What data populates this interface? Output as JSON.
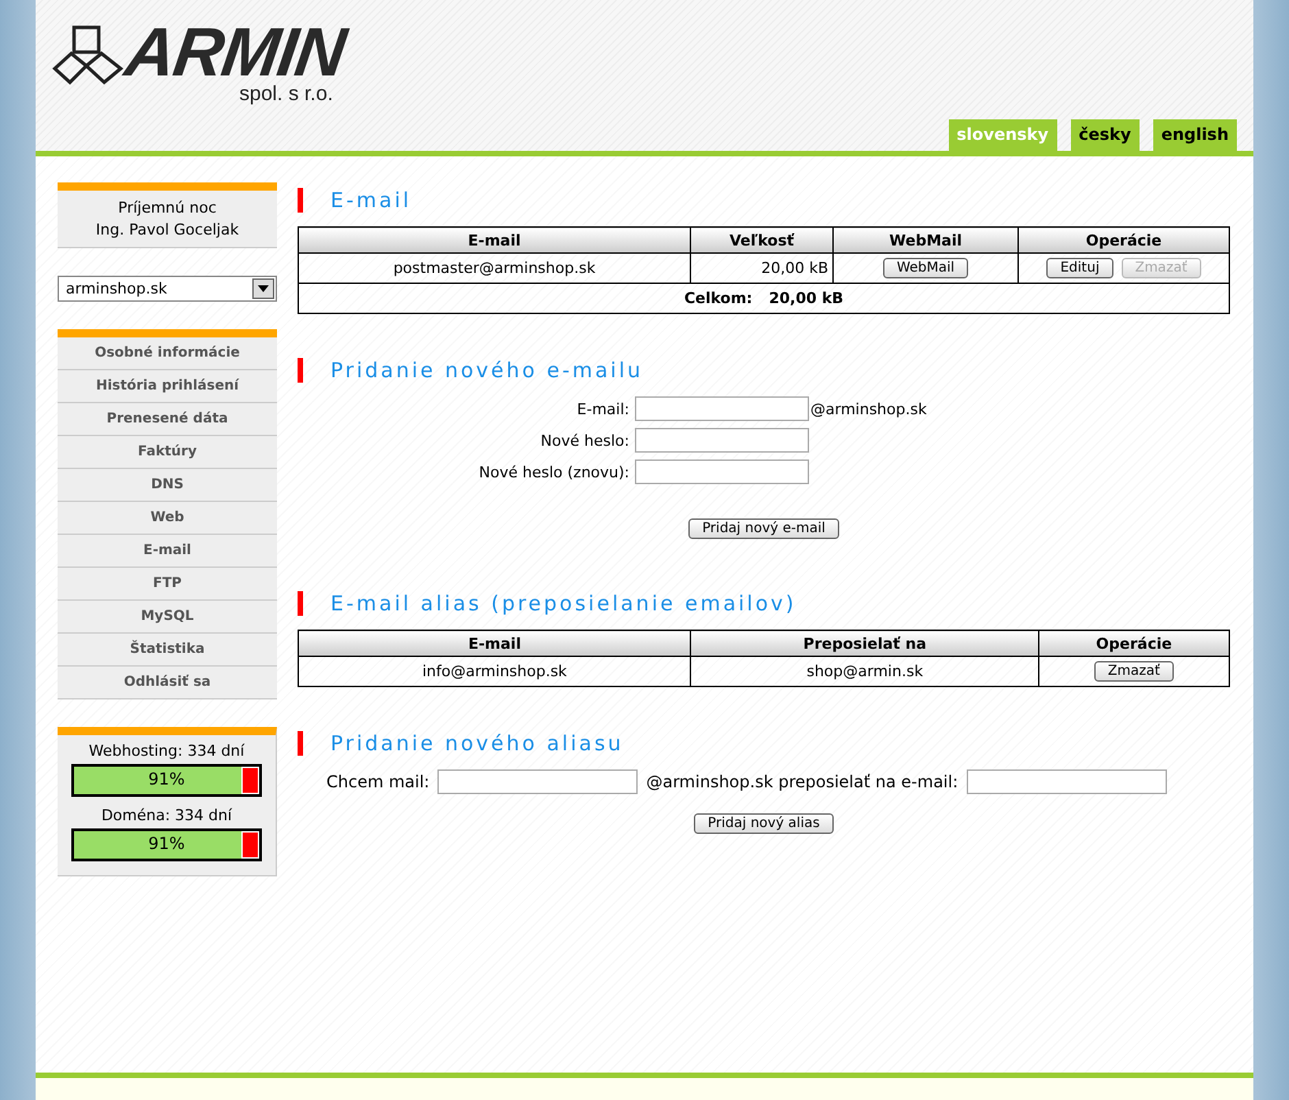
{
  "header": {
    "logo_name": "ARMIN",
    "logo_sub": "spol. s r.o.",
    "languages": [
      {
        "label": "slovensky",
        "selected": true
      },
      {
        "label": "česky",
        "selected": false
      },
      {
        "label": "english",
        "selected": false
      }
    ]
  },
  "sidebar": {
    "greeting": [
      "Príjemnú noc",
      "Ing. Pavol Goceljak"
    ],
    "domain_select": {
      "value": "arminshop.sk"
    },
    "menu": [
      {
        "label": "Osobné informácie"
      },
      {
        "label": "História prihlásení"
      },
      {
        "label": "Prenesené dáta"
      },
      {
        "label": "Faktúry"
      },
      {
        "label": "DNS"
      },
      {
        "label": "Web"
      },
      {
        "label": "E-mail"
      },
      {
        "label": "FTP"
      },
      {
        "label": "MySQL"
      },
      {
        "label": "Štatistika"
      },
      {
        "label": "Odhlásiť sa"
      }
    ],
    "quotas": [
      {
        "label": "Webhosting: 334 dní",
        "level": 0.91,
        "reading": "91%"
      },
      {
        "label": "Doména: 334 dní",
        "level": 0.91,
        "reading": "91%"
      }
    ]
  },
  "email_section": {
    "title": "E-mail",
    "columns": [
      "E-mail",
      "Veľkosť",
      "WebMail",
      "Operácie"
    ],
    "rows": [
      {
        "email": "postmaster@arminshop.sk",
        "size": "20,00 kB",
        "webmail": {
          "label": "WebMail",
          "disabled": false
        },
        "edit": {
          "label": "Edituj",
          "disabled": false
        },
        "delete": {
          "label": "Zmazať",
          "disabled": true
        }
      }
    ],
    "total_label": "Celkom:",
    "total_value": "20,00 kB"
  },
  "add_email": {
    "title": "Pridanie nového e-mailu",
    "fields": [
      {
        "label": "E-mail:",
        "suffix": "@arminshop.sk"
      },
      {
        "label": "Nové heslo:"
      },
      {
        "label": "Nové heslo (znovu):"
      }
    ],
    "button": "Pridaj nový e-mail"
  },
  "alias_section": {
    "title": "E-mail alias (preposielanie emailov)",
    "columns": [
      "E-mail",
      "Preposielať na",
      "Operácie"
    ],
    "rows": [
      {
        "email": "info@arminshop.sk",
        "forward": "shop@armin.sk",
        "delete": {
          "label": "Zmazať",
          "disabled": false
        }
      }
    ]
  },
  "add_alias": {
    "title": "Pridanie nového aliasu",
    "label": "Chcem mail:",
    "middle": "@arminshop.sk preposielať na e-mail:",
    "button": "Pridaj nový alias"
  }
}
